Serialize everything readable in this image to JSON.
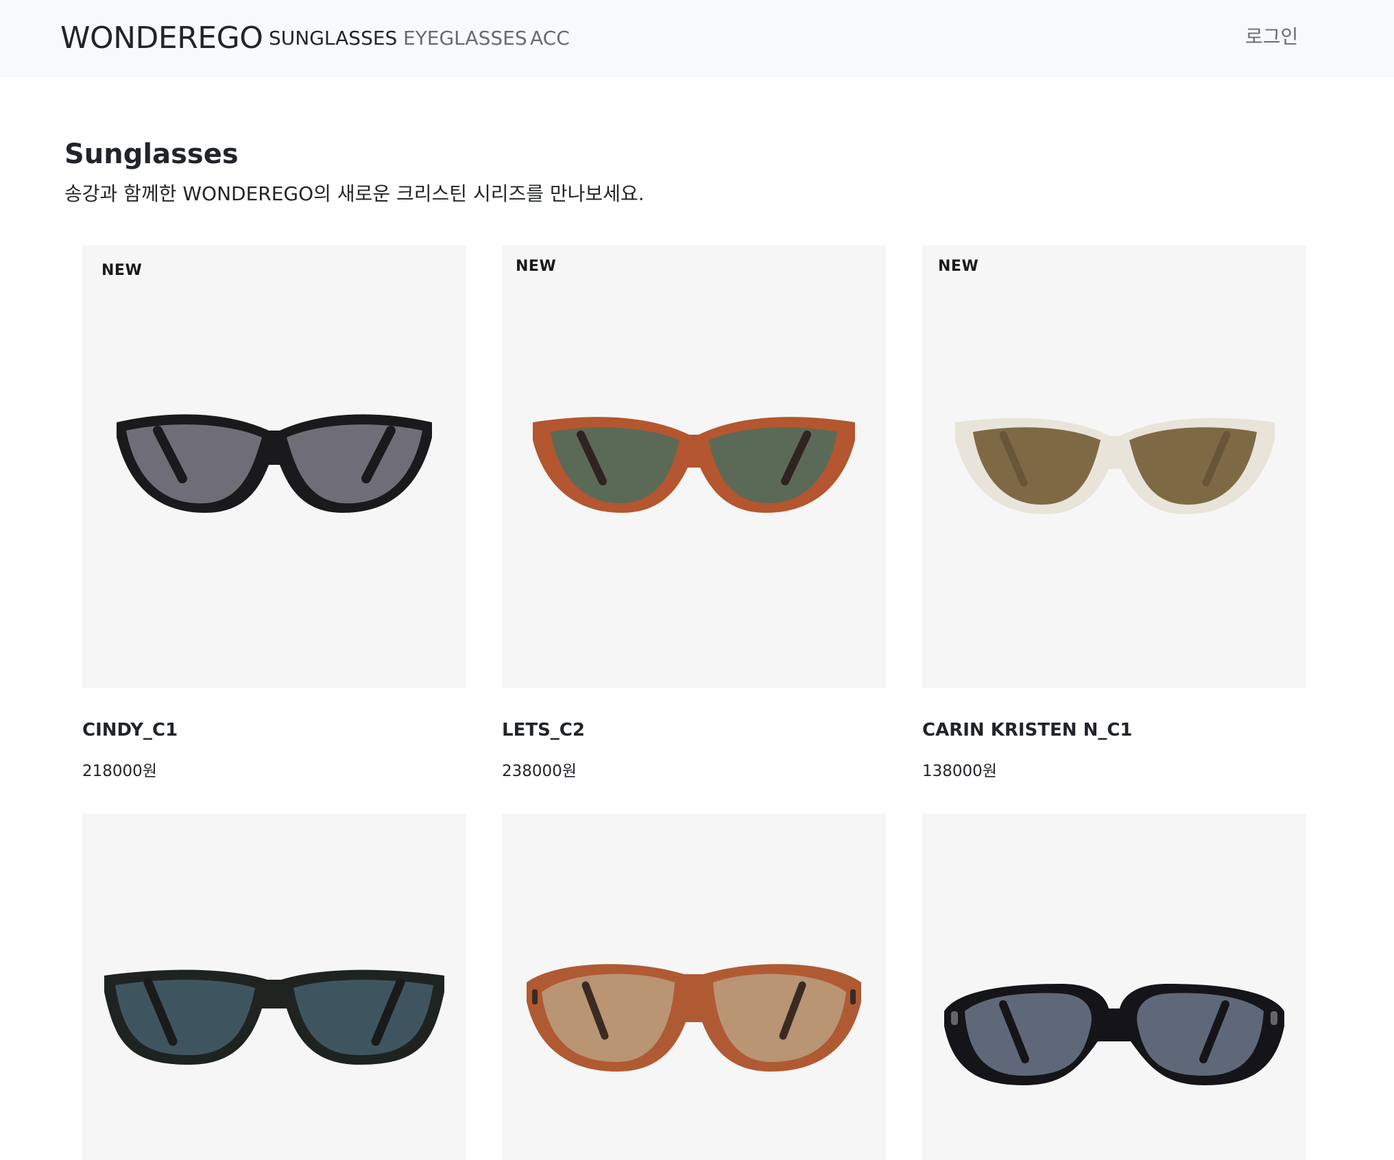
{
  "navbar": {
    "brand": "WONDEREGO",
    "links": [
      "SUNGLASSES",
      "EYEGLASSES",
      "ACC"
    ],
    "login": "로그인"
  },
  "page": {
    "title": "Sunglasses",
    "subtitle": "송강과 함께한 WONDEREGO의 새로운 크리스틴 시리즈를 만나보세요."
  },
  "products": [
    {
      "badge": "NEW",
      "name": "CINDY_C1",
      "price": "218000원",
      "frame_color": "#1a1a1c",
      "lens_color": "#6f6e78"
    },
    {
      "badge": "NEW",
      "name": "LETS_C2",
      "price": "238000원",
      "frame_color": "#b4562f",
      "lens_color": "#5b6a56"
    },
    {
      "badge": "NEW",
      "name": "CARIN KRISTEN N_C1",
      "price": "138000원",
      "frame_color": "#e9e4da",
      "lens_color": "#7d6a45"
    },
    {
      "badge": "",
      "name": "",
      "price": "",
      "frame_color": "#1f2320",
      "lens_color": "#3e5560"
    },
    {
      "badge": "",
      "name": "",
      "price": "",
      "frame_color": "#b05a33",
      "lens_color": "#b99574"
    },
    {
      "badge": "",
      "name": "",
      "price": "",
      "frame_color": "#151519",
      "lens_color": "#5e6878"
    }
  ]
}
